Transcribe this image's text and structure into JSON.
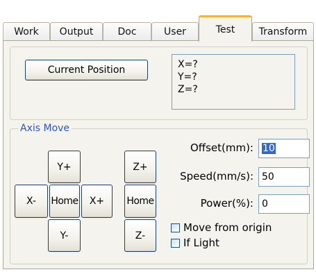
{
  "tabs": [
    {
      "label": "Work"
    },
    {
      "label": "Output"
    },
    {
      "label": "Doc"
    },
    {
      "label": "User"
    },
    {
      "label": "Test",
      "active": true
    },
    {
      "label": "Transform"
    }
  ],
  "position": {
    "button_label": "Current Position",
    "x": "X=?",
    "y": "Y=?",
    "z": "Z=?"
  },
  "axis_move": {
    "title": "Axis Move",
    "buttons": {
      "y_plus": "Y+",
      "y_minus": "Y-",
      "x_minus": "X-",
      "x_plus": "X+",
      "home_xy": "Home",
      "z_plus": "Z+",
      "z_minus": "Z-",
      "home_z": "Home"
    },
    "offset_label": "Offset(mm):",
    "offset_value": "10",
    "speed_label": "Speed(mm/s):",
    "speed_value": "50",
    "power_label": "Power(%):",
    "power_value": "0",
    "move_from_origin_label": "Move from origin",
    "move_from_origin_checked": false,
    "if_light_label": "If Light",
    "if_light_checked": false
  },
  "colors": {
    "active_tab_accent": "#f2b53a",
    "group_title": "#2c56c4",
    "selection": "#316ac5",
    "button_border": "#1c3c7c"
  }
}
